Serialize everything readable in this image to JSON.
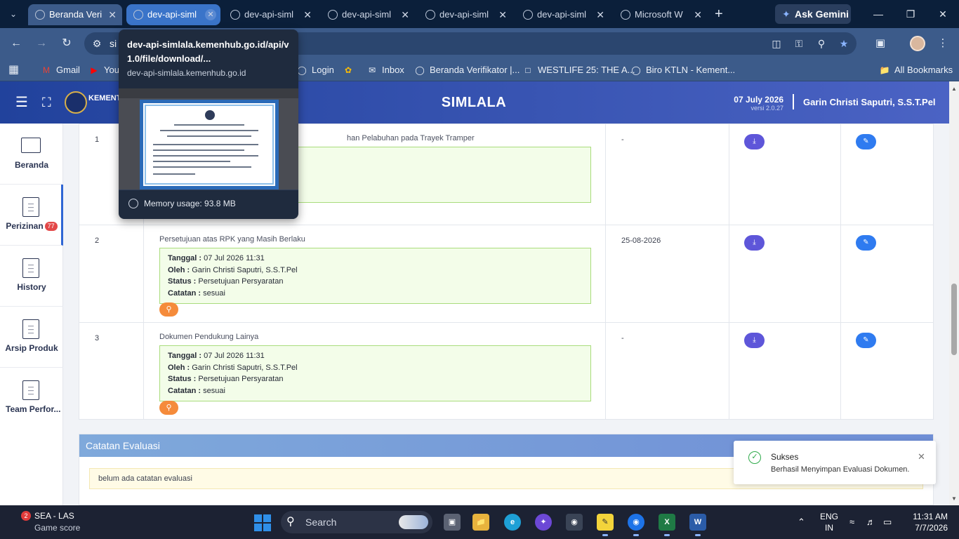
{
  "browser": {
    "tabs": [
      {
        "title": "Beranda Veri"
      },
      {
        "title": "dev-api-siml"
      },
      {
        "title": "dev-api-siml"
      },
      {
        "title": "dev-api-siml"
      },
      {
        "title": "dev-api-siml"
      },
      {
        "title": "dev-api-siml"
      },
      {
        "title": "Microsoft W"
      }
    ],
    "new_tab": "+",
    "gemini_label": "Ask Gemini",
    "address_text": "si",
    "bookmarks": [
      {
        "label": "Gmail",
        "icon": "gmail-icon"
      },
      {
        "label": "You",
        "icon": "youtube-icon"
      },
      {
        "label": "Login",
        "icon": "globe-icon"
      },
      {
        "label": "",
        "icon": "photos-icon"
      },
      {
        "label": "Inbox",
        "icon": "mail-icon"
      },
      {
        "label": "Beranda Verifikator |...",
        "icon": "globe-icon"
      },
      {
        "label": "WESTLIFE 25: THE A...",
        "icon": "page-icon"
      },
      {
        "label": "Biro KTLN - Kement...",
        "icon": "globe-icon"
      }
    ],
    "all_bookmarks": "All Bookmarks",
    "hover_card": {
      "title": "dev-api-simlala.kemenhub.go.id/api/v1.0/file/download/...",
      "domain": "dev-api-simlala.kemenhub.go.id",
      "memory": "Memory usage: 93.8 MB"
    }
  },
  "app": {
    "ministry_short": "KEMENTE REPUBLI",
    "brand": "SIMLALA",
    "date": "07 July 2026",
    "version": "versi 2.0.27",
    "user": "Garin Christi Saputri, S.S.T.Pel"
  },
  "sidebar": {
    "items": [
      {
        "label": "Beranda",
        "icon": "monitor-icon"
      },
      {
        "label": "Perizinan",
        "icon": "document-icon",
        "badge": "77"
      },
      {
        "label": "History",
        "icon": "document-icon"
      },
      {
        "label": "Arsip Produk",
        "icon": "document-icon"
      },
      {
        "label": "Team Perfor...",
        "icon": "document-icon"
      }
    ]
  },
  "documents": {
    "rows": [
      {
        "no": "1",
        "title": "han Pelabuhan pada Trayek Tramper",
        "expiry": "-"
      },
      {
        "no": "2",
        "title": "Persetujuan atas RPK yang Masih Berlaku",
        "tanggal_label": "Tanggal :",
        "tanggal": "07 Jul 2026 11:31",
        "oleh_label": "Oleh :",
        "oleh": "Garin Christi Saputri, S.S.T.Pel",
        "status_label": "Status :",
        "status": "Persetujuan Persyaratan",
        "catatan_label": "Catatan :",
        "catatan": "sesuai",
        "expiry": "25-08-2026"
      },
      {
        "no": "3",
        "title": "Dokumen Pendukung Lainya",
        "tanggal_label": "Tanggal :",
        "tanggal": "07 Jul 2026 11:31",
        "oleh_label": "Oleh :",
        "oleh": "Garin Christi Saputri, S.S.T.Pel",
        "status_label": "Status :",
        "status": "Persetujuan Persyaratan",
        "catatan_label": "Catatan :",
        "catatan": "sesuai",
        "expiry": "-"
      }
    ]
  },
  "evaluation": {
    "title": "Catatan Evaluasi",
    "note": "belum ada catatan evaluasi"
  },
  "toast": {
    "title": "Sukses",
    "message": "Berhasil Menyimpan Evaluasi Dokumen."
  },
  "taskbar": {
    "weather_badge": "2",
    "weather_title": "SEA - LAS",
    "weather_sub": "Game score",
    "search": "Search",
    "lang1": "ENG",
    "lang2": "IN",
    "time": "11:31 AM",
    "date": "7/7/2026"
  },
  "colors": {
    "header_start": "#21429c",
    "header_end": "#4b63c4",
    "success_box": "#f3fde9",
    "preview_button": "#f58b3b",
    "download_button": "#5e56d9",
    "edit_button": "#2f7bf0"
  }
}
